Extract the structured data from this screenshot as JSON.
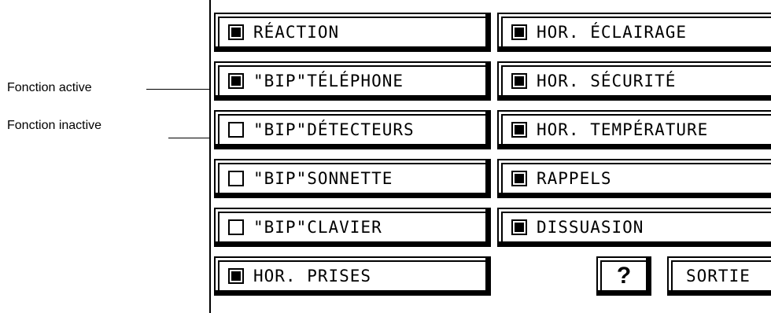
{
  "annotations": {
    "active": "Fonction active",
    "inactive": "Fonction inactive"
  },
  "left_column": [
    {
      "label": "RÉACTION",
      "checked": true
    },
    {
      "label": "\"BIP\"TÉLÉPHONE",
      "checked": true
    },
    {
      "label": "\"BIP\"DÉTECTEURS",
      "checked": false
    },
    {
      "label": "\"BIP\"SONNETTE",
      "checked": false
    },
    {
      "label": "\"BIP\"CLAVIER",
      "checked": false
    },
    {
      "label": "HOR. PRISES",
      "checked": true
    }
  ],
  "right_column": [
    {
      "label": "HOR. ÉCLAIRAGE",
      "checked": true
    },
    {
      "label": "HOR. SÉCURITÉ",
      "checked": true
    },
    {
      "label": "HOR. TEMPÉRATURE",
      "checked": true
    },
    {
      "label": "RAPPELS",
      "checked": true
    },
    {
      "label": "DISSUASION",
      "checked": true
    }
  ],
  "actions": {
    "help_label": "?",
    "exit_label": "SORTIE"
  }
}
